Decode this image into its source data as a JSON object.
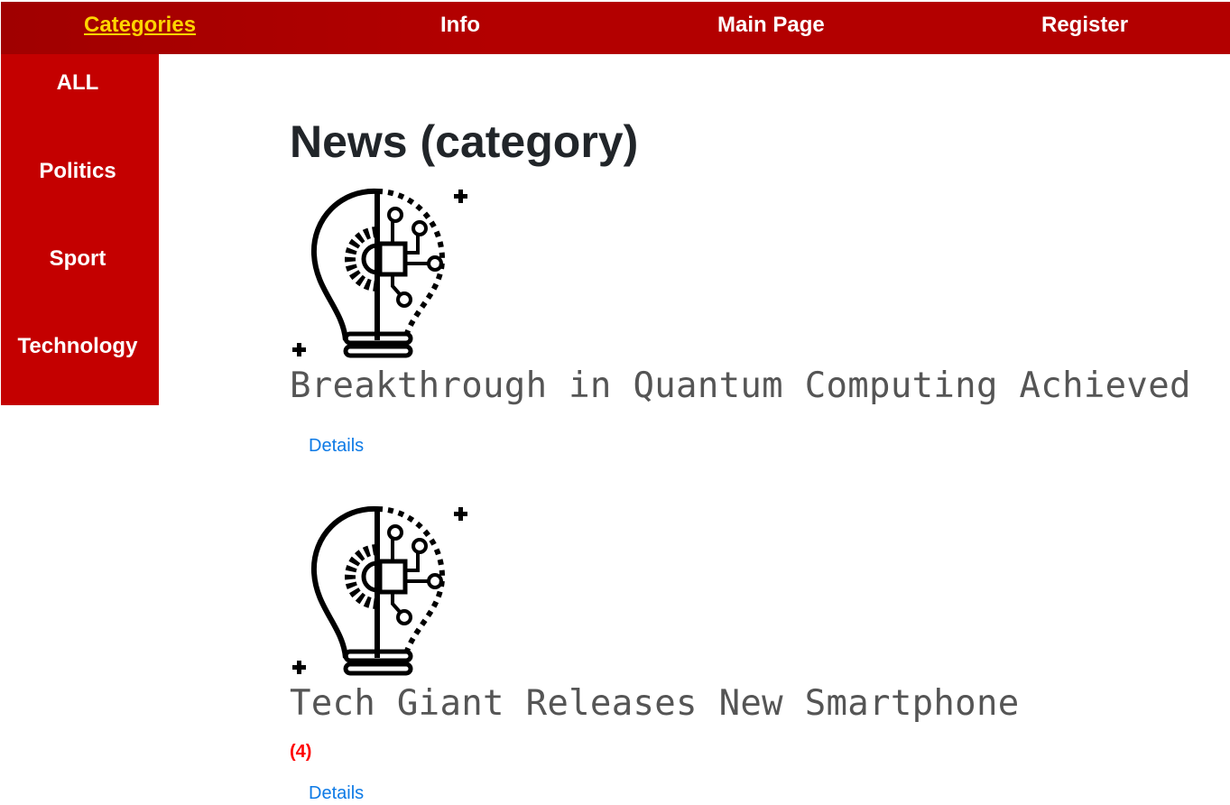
{
  "topnav": {
    "categories": "Categories",
    "info": "Info",
    "main_page": "Main Page",
    "register": "Register"
  },
  "sidebar": {
    "items": [
      {
        "label": "ALL"
      },
      {
        "label": "Politics"
      },
      {
        "label": "Sport"
      },
      {
        "label": "Technology"
      }
    ]
  },
  "main": {
    "heading": "News (category)",
    "news": [
      {
        "title": "Breakthrough in Quantum Computing Achieved",
        "count": "",
        "details_label": "Details",
        "icon": "lightbulb-chip-icon"
      },
      {
        "title": "Tech Giant Releases New Smartphone",
        "count": "(4)",
        "details_label": "Details",
        "icon": "lightbulb-chip-icon"
      }
    ]
  },
  "colors": {
    "nav_bg": "#b30000",
    "sidebar_bg": "#c40000",
    "active_link": "#ffd400",
    "details_link": "#0d7ae6",
    "count": "#ff0000"
  }
}
